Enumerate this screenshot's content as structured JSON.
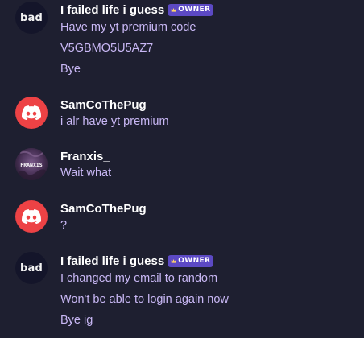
{
  "messages": [
    {
      "author": "I failed life i guess",
      "avatar_text": "bad",
      "badge": "OWNER",
      "lines": [
        "Have my yt premium code",
        "V5GBMO5U5AZ7",
        "Bye"
      ]
    },
    {
      "author": "SamCoThePug",
      "avatar_icon": "discord-logo-icon",
      "lines": [
        "i alr have yt premium"
      ]
    },
    {
      "author": "Franxis_",
      "avatar_icon": "user-avatar-image",
      "avatar_text": "FRANXIS",
      "lines": [
        "Wait what"
      ]
    },
    {
      "author": "SamCoThePug",
      "avatar_icon": "discord-logo-icon",
      "lines": [
        "?"
      ]
    },
    {
      "author": "I failed life i guess",
      "avatar_text": "bad",
      "badge": "OWNER",
      "lines": [
        "I changed my email to random",
        "Won't be able to login again now",
        "Bye ig"
      ]
    }
  ],
  "colors": {
    "background": "#1e1f30",
    "message_text": "#c9b8f5",
    "username": "#ffffff",
    "owner_badge": "#5c49c4",
    "discord_avatar": "#ed4245"
  }
}
